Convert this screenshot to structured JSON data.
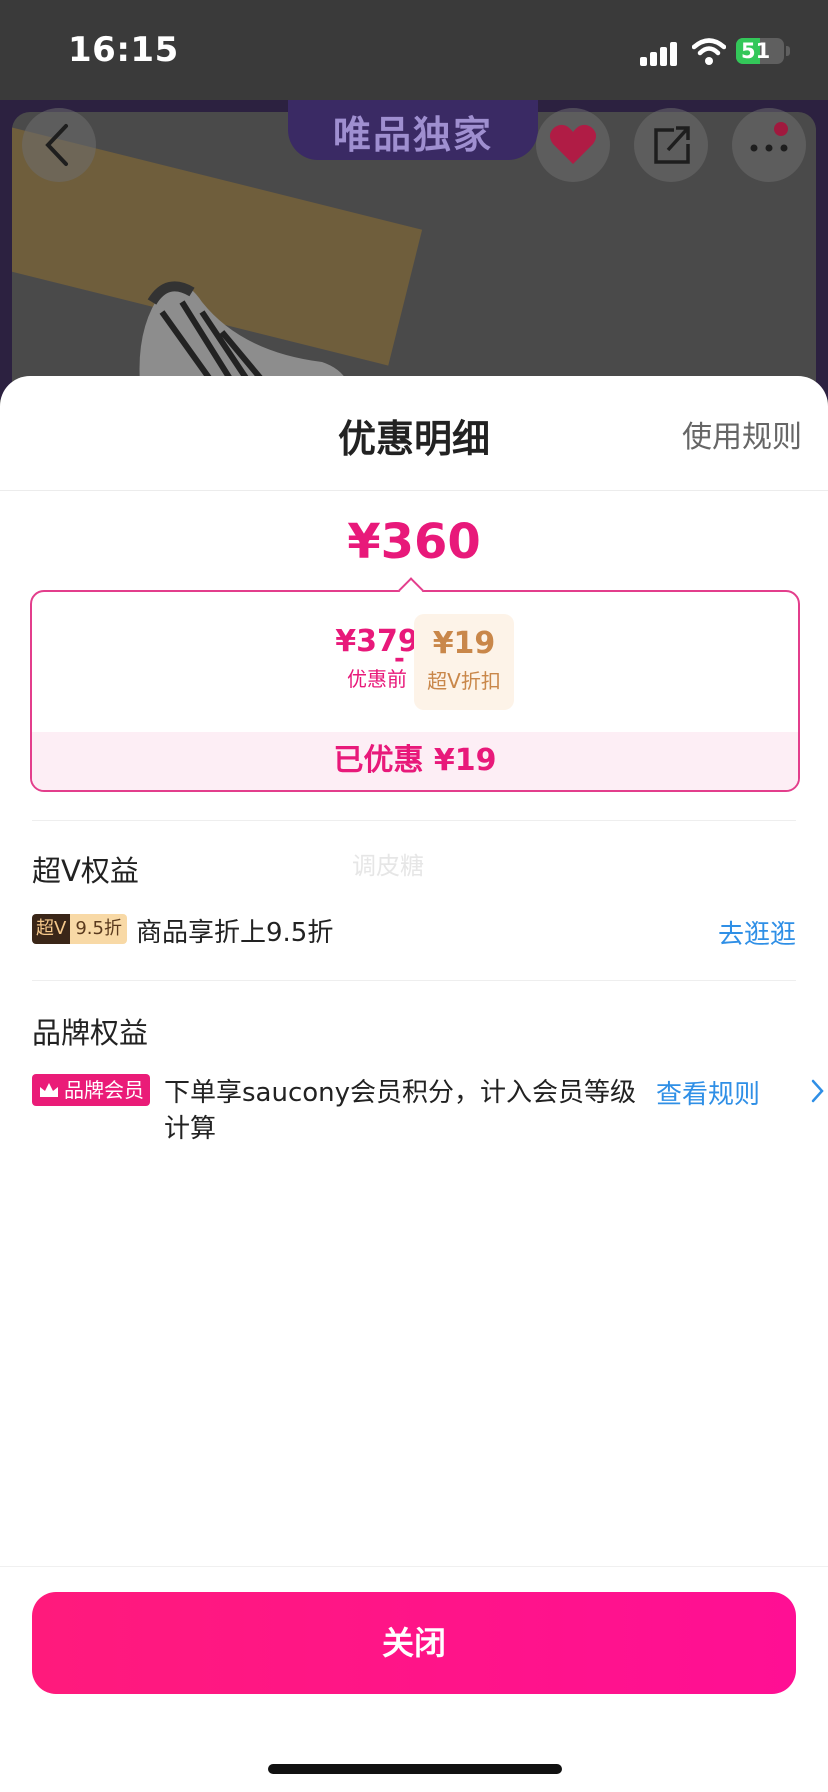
{
  "status_bar": {
    "time": "16:15",
    "battery": "51",
    "battery_level": 0.51
  },
  "banner": {
    "brand_text": "唯品独家",
    "icons": [
      "back-icon",
      "heart-icon",
      "share-icon",
      "more-icon"
    ],
    "colors": {
      "frame": "#2c2140",
      "heart": "#b01c45"
    }
  },
  "sheet": {
    "title": "优惠明细",
    "rules_link": "使用规则",
    "final_price": "¥360",
    "breakdown": {
      "original_price": "¥379",
      "original_label": "优惠前",
      "operator": "-",
      "discount_price": "¥19",
      "discount_label": "超V折扣",
      "saved_text": "已优惠 ¥19"
    },
    "super_v": {
      "title": "超V权益",
      "badge_a": "超V",
      "badge_b": "9.5折",
      "description": "商品享折上9.5折",
      "link": "去逛逛"
    },
    "watermark": "调皮糖",
    "brand": {
      "title": "品牌权益",
      "badge": "品牌会员",
      "description_line1": "下单享saucony会员积分，计入会员等级",
      "description_line2": "计算",
      "link": "查看规则"
    },
    "close_button": "关闭",
    "accent_color": "#e8197a",
    "link_color": "#2f8fe6"
  }
}
